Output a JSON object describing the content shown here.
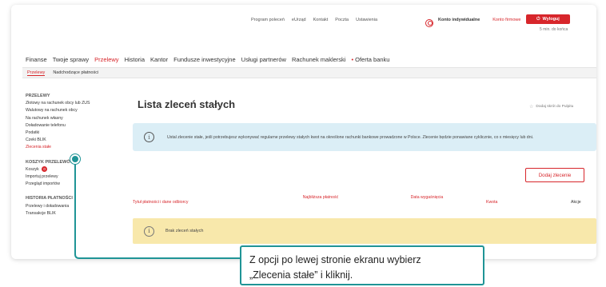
{
  "top_links": [
    "Program poleceń",
    "eUrząd",
    "Kontakt",
    "Poczta",
    "Ustawienia"
  ],
  "account": {
    "type": "Konto indywidualne",
    "change_link": "Konto firmowe",
    "logout_label": "Wyloguj",
    "session_timer": "5 min. do końca"
  },
  "main_nav": [
    {
      "label": "Finanse",
      "active": false
    },
    {
      "label": "Twoje sprawy",
      "active": false
    },
    {
      "label": "Przelewy",
      "active": true
    },
    {
      "label": "Historia",
      "active": false
    },
    {
      "label": "Kantor",
      "active": false
    },
    {
      "label": "Fundusze inwestycyjne",
      "active": false
    },
    {
      "label": "Usługi partnerów",
      "active": false
    },
    {
      "label": "Rachunek maklerski",
      "active": false
    },
    {
      "label": "Oferta banku",
      "active": false
    }
  ],
  "sub_nav": [
    {
      "label": "Przelewy",
      "active": true
    },
    {
      "label": "Nadchodzące płatności",
      "active": false
    }
  ],
  "sidebar": {
    "section1_title": "PRZELEWY",
    "section1_items": [
      {
        "label": "Złotowy na rachunek obcy lub ZUS"
      },
      {
        "label": "Walutowy na rachunek obcy"
      },
      {
        "label": "Na rachunek własny"
      },
      {
        "label": "Doładowanie telefonu"
      },
      {
        "label": "Podatki"
      },
      {
        "label": "Czeki BLIK"
      },
      {
        "label": "Zlecenia stałe"
      }
    ],
    "section2_title": "KOSZYK PRZELEWÓW",
    "basket_label": "Koszyk",
    "basket_count": "0",
    "import_label": "Importuj przelewy",
    "import_review_label": "Przegląd importów",
    "section3_title": "HISTORIA PŁATNOŚCI",
    "section3_items": [
      {
        "label": "Przelewy i doładowania"
      },
      {
        "label": "Transakcje BLIK"
      }
    ]
  },
  "content": {
    "title": "Lista zleceń stałych",
    "pin_label": "Dodaj skrót do Pulpitu",
    "info_icon": "i",
    "info_text": "Ustal zlecenie stałe, jeśli potrzebujesz wykonywać regularne przelewy stałych kwot na określone rachunki bankowe prowadzone w Polsce. Zlecenie będzie ponawiane cyklicznie, co x miesięcy lub dni.",
    "add_button": "Dodaj zlecenie",
    "columns": [
      "Tytuł płatności i dane odbiorcy",
      "Najbliższa płatność",
      "Data wygaśnięcia",
      "Kwota",
      "Akcje"
    ],
    "empty_text": "Brak zleceń stałych"
  },
  "callout": {
    "line1": "Z opcji po lewej stronie ekranu wybierz",
    "line2": "„Zlecenia stałe” i kliknij."
  },
  "colors": {
    "accent": "#d7262b",
    "callout": "#1f9496",
    "info_bg": "#dbeef6",
    "empty_bg": "#f8e8ab"
  }
}
